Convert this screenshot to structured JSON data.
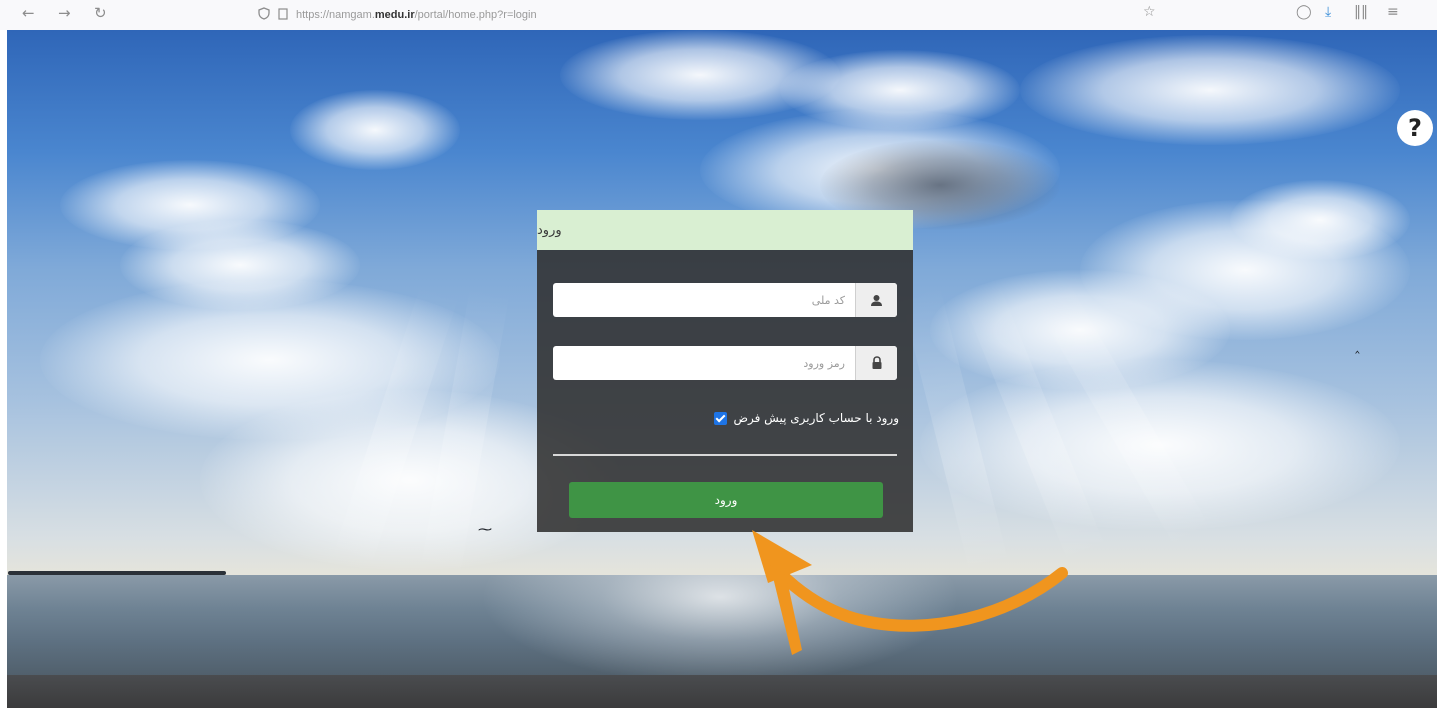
{
  "browser": {
    "url_prefix": "https://namgam.",
    "url_domain": "medu.ir",
    "url_path": "/portal/home.php?r=login",
    "icons": [
      "back-arrow-icon",
      "forward-arrow-icon",
      "reload-icon",
      "shield-icon",
      "page-icon",
      "bookmark-star-icon",
      "pocket-icon",
      "download-icon",
      "library-icon",
      "menu-icon"
    ]
  },
  "help": {
    "label": "?"
  },
  "login": {
    "header_title": "ورود",
    "national_code_placeholder": "کد ملی",
    "password_placeholder": "رمز ورود",
    "remember_label": "ورود با حساب کاربری پیش فرض",
    "remember_checked": true,
    "submit_label": "ورود"
  },
  "colors": {
    "header_bg": "#d9efd2",
    "panel_bg": "#303030",
    "button_green": "#3f9445",
    "checkbox_blue": "#1e74e6",
    "arrow_orange": "#f0951e"
  }
}
